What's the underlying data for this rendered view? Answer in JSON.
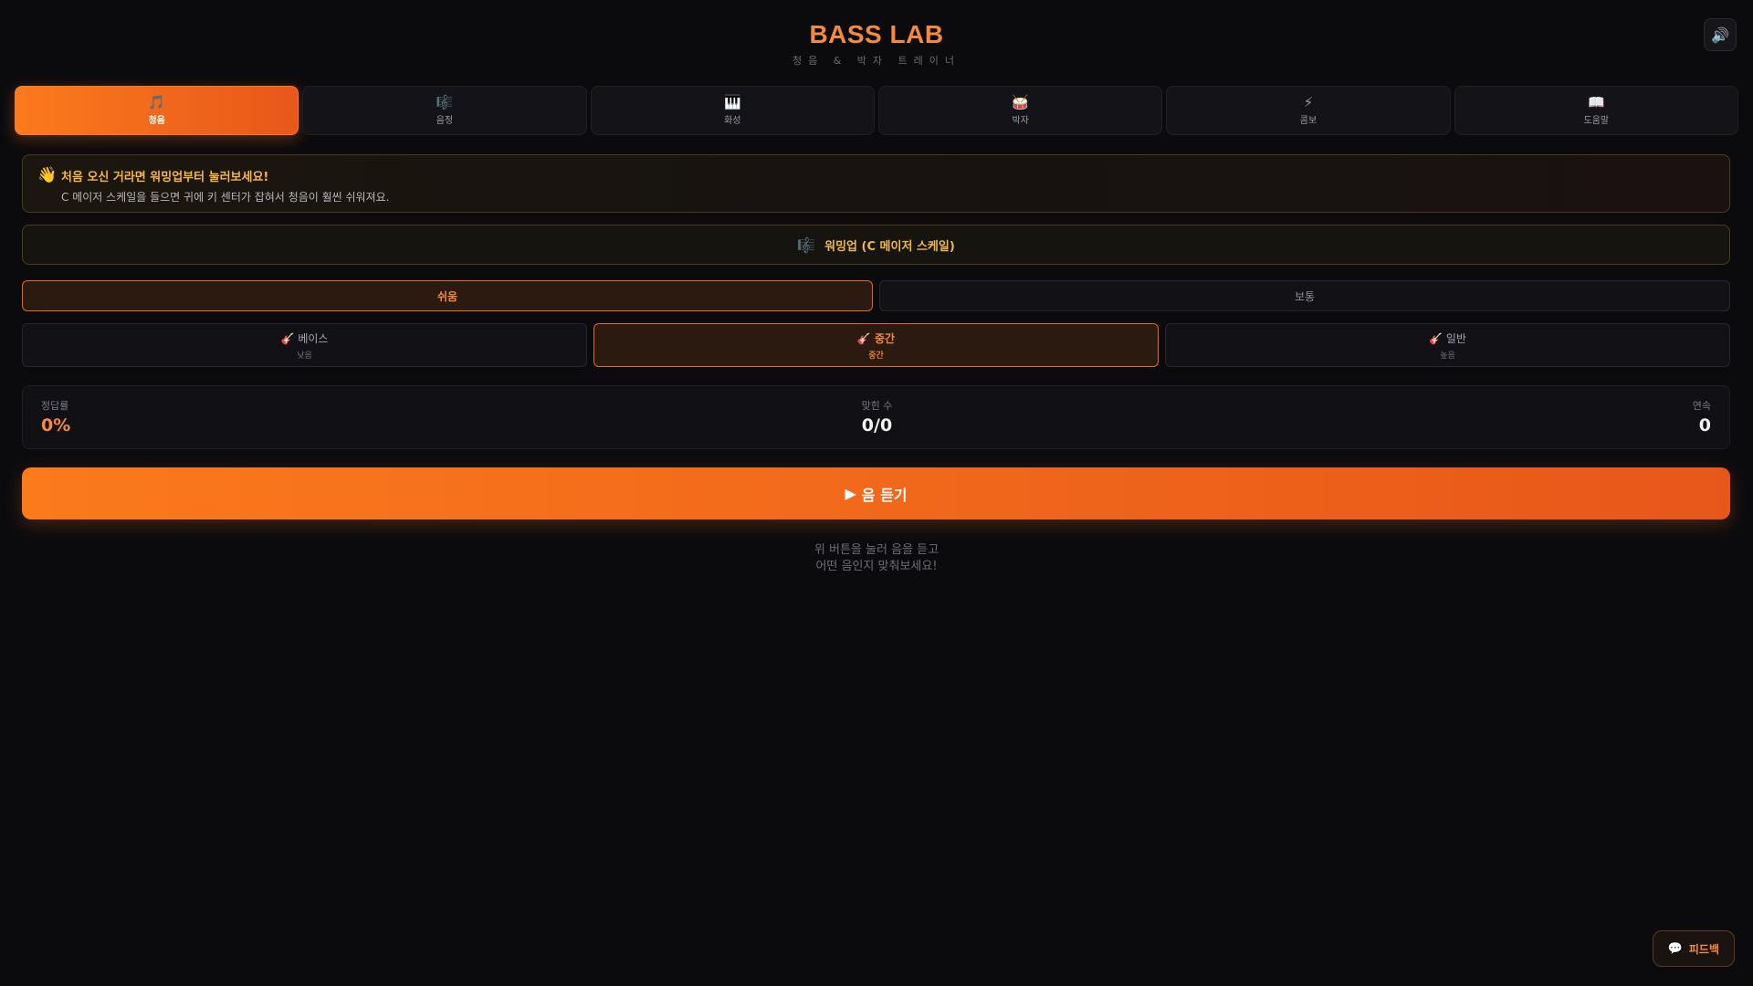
{
  "header": {
    "title": "BASS LAB",
    "subtitle": "청음 & 박자 트레이너",
    "sound_icon": "🔊"
  },
  "tabs": [
    {
      "icon": "🎵",
      "label": "청음",
      "active": true
    },
    {
      "icon": "🎼",
      "label": "음정",
      "active": false
    },
    {
      "icon": "🎹",
      "label": "화성",
      "active": false
    },
    {
      "icon": "🥁",
      "label": "박자",
      "active": false
    },
    {
      "icon": "⚡",
      "label": "콤보",
      "active": false
    },
    {
      "icon": "📖",
      "label": "도움말",
      "active": false
    }
  ],
  "welcome": {
    "icon": "👋",
    "title": "처음 오신 거라면 워밍업부터 눌러보세요!",
    "description": "C 메이저 스케일을 들으면 귀에 키 센터가 잡혀서 청음이 훨씬 쉬워져요."
  },
  "warmup": {
    "icon": "🎼",
    "label": "워밍업 (C 메이저 스케일)"
  },
  "difficulty": [
    {
      "label": "쉬움",
      "active": true
    },
    {
      "label": "보통",
      "active": false
    }
  ],
  "ranges": [
    {
      "icon": "🎸",
      "label": "베이스",
      "sub": "낮음",
      "active": false
    },
    {
      "icon": "🎸",
      "label": "중간",
      "sub": "중간",
      "active": true
    },
    {
      "icon": "🎸",
      "label": "일반",
      "sub": "높음",
      "active": false
    }
  ],
  "stats": {
    "accuracy_label": "정답률",
    "accuracy_value": "0%",
    "correct_label": "맞힌 수",
    "correct_value": "0/0",
    "streak_label": "연속",
    "streak_value": "0"
  },
  "play": {
    "icon": "▶",
    "label": "음 듣기"
  },
  "hint": {
    "line1": "위 버튼을 눌러 음을 듣고",
    "line2": "어떤 음인지 맞춰보세요!"
  },
  "feedback": {
    "icon": "💬",
    "label": "피드백"
  },
  "colors": {
    "accent": "#fb7a1c",
    "accent_dark": "#e8571a",
    "warm_text": "#f6b73c",
    "background": "#0b0b0e"
  }
}
